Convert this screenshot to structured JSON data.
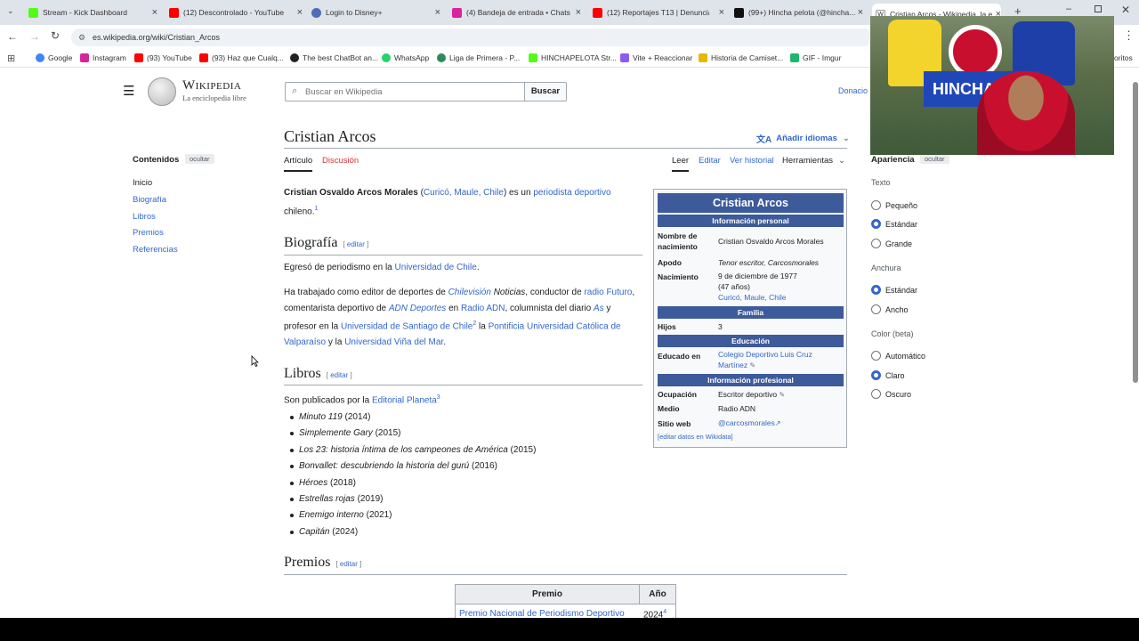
{
  "browser": {
    "tabs": [
      {
        "title": "Stream - Kick Dashboard",
        "color": "#53fc18"
      },
      {
        "title": "(12) Descontrolado - YouTube",
        "color": "#ff0000"
      },
      {
        "title": "Login to Disney+",
        "color": "#4a6fb5"
      },
      {
        "title": "(4) Bandeja de entrada • Chats",
        "color": "#d6249f"
      },
      {
        "title": "(12) Reportajes T13 | Denuncia",
        "color": "#ff0000"
      },
      {
        "title": "(99+) Hincha pelota (@hincha...",
        "color": "#111111"
      },
      {
        "title": "Cristian Arcos - Wikipedia, la e...",
        "color": "#888888"
      }
    ],
    "url": "es.wikipedia.org/wiki/Cristian_Arcos",
    "bookmarks": [
      "Google",
      "Instagram",
      "(93) YouTube",
      "(93) Haz que Cualq...",
      "The best ChatBot an...",
      "WhatsApp",
      "Liga de Primera - P...",
      "HINCHAPELOTA Str...",
      "Vite + Reaccionar",
      "Historia de Camiset...",
      "GIF - Imgur"
    ],
    "bookmarks_more": "oritos"
  },
  "header": {
    "logo_title": "Wikipedia",
    "logo_sub": "La enciclopedia libre",
    "search_placeholder": "Buscar en Wikipedia",
    "search_button": "Buscar",
    "donate": "Donacio"
  },
  "toc": {
    "title": "Contenidos",
    "hide": "ocultar",
    "items": [
      "Inicio",
      "Biografía",
      "Libros",
      "Premios",
      "Referencias"
    ]
  },
  "article": {
    "title": "Cristian Arcos",
    "add_languages": "Añadir idiomas",
    "tabs": [
      "Artículo",
      "Discusión"
    ],
    "actions": [
      "Leer",
      "Editar",
      "Ver historial",
      "Herramientas"
    ],
    "intro": {
      "name": "Cristian Osvaldo Arcos Morales",
      "place": "Curicó, Maule, Chile",
      "mid": ") es un ",
      "link": "periodista deportivo",
      "end": " chileno.",
      "ref": "1"
    },
    "edit_label": "editar",
    "bio_heading": "Biografía",
    "bio_p1": {
      "t1": "Egresó de periodismo en la ",
      "l1": "Universidad de Chile",
      "t2": "."
    },
    "bio_p2": {
      "t1": "Ha trabajado como editor de deportes de ",
      "l1": "Chilevisión",
      "t2": " Noticias",
      "t3": ", conductor de ",
      "l2": "radio Futuro",
      "t4": ", comentarista deportivo de ",
      "l3": "ADN Deportes",
      "t5": " en ",
      "l4": "Radio ADN",
      "t6": ", columnista del diario ",
      "l5": "As",
      "t7": " y profesor en la ",
      "l6": "Universidad de Santiago de Chile",
      "r": "2",
      "t8": "  la ",
      "l7": "Pontificia Universidad Católica de Valparaíso",
      "t9": " y la ",
      "l8": "Universidad Viña del Mar",
      "t10": "."
    },
    "books_heading": "Libros",
    "books_intro": {
      "t1": "Son publicados por la ",
      "l1": "Editorial Planeta",
      "r": "3"
    },
    "books": [
      {
        "title": "Minuto 119",
        "year": "(2014)"
      },
      {
        "title": "Simplemente Gary",
        "year": "(2015)"
      },
      {
        "title": "Los 23: historia íntima de los campeones de América",
        "year": "(2015)"
      },
      {
        "title": "Bonvallet: descubriendo la historia del gurú",
        "year": "(2016)"
      },
      {
        "title": "Héroes",
        "year": "(2018)"
      },
      {
        "title": "Estrellas rojas",
        "year": "(2019)"
      },
      {
        "title": "Enemigo interno",
        "year": "(2021)"
      },
      {
        "title": "Capitán",
        "year": "(2024)"
      }
    ],
    "awards_heading": "Premios",
    "awards_table": {
      "headers": [
        "Premio",
        "Año"
      ],
      "rows": [
        {
          "award": "Premio Nacional de Periodismo Deportivo",
          "year": "2024",
          "ref": "4"
        }
      ]
    }
  },
  "infobox": {
    "title": "Cristian Arcos",
    "sec_personal": "Información personal",
    "birth_name_label": "Nombre de nacimiento",
    "birth_name": "Cristian Osvaldo Arcos Morales",
    "nickname_label": "Apodo",
    "nickname": "Tenor escritor, Carcosmorales",
    "birth_label": "Nacimiento",
    "birth_date": "9 de diciembre de 1977",
    "birth_age": "(47 años)",
    "birth_place": "Curicó, Maule, Chile",
    "sec_family": "Familia",
    "children_label": "Hijos",
    "children": "3",
    "sec_education": "Educación",
    "educated_label": "Educado en",
    "educated": "Colegio Deportivo Luis Cruz Martínez",
    "sec_professional": "Información profesional",
    "occupation_label": "Ocupación",
    "occupation": "Escritor deportivo",
    "medium_label": "Medio",
    "medium": "Radio ADN",
    "website_label": "Sitio web",
    "website": "@carcosmorales",
    "wikidata": "[editar datos en Wikidata]"
  },
  "appearance": {
    "title": "Apariencia",
    "hide": "ocultar",
    "text_label": "Texto",
    "text_options": [
      "Pequeño",
      "Estándar",
      "Grande"
    ],
    "width_label": "Anchura",
    "width_options": [
      "Estándar",
      "Ancho"
    ],
    "color_label": "Color (beta)",
    "color_options": [
      "Automático",
      "Claro",
      "Oscuro"
    ]
  }
}
